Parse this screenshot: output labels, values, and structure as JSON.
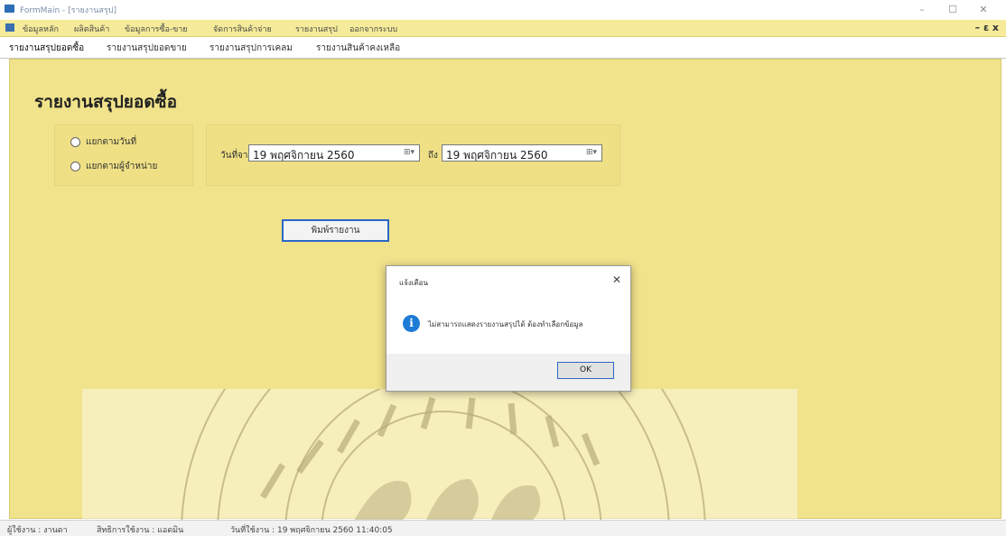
{
  "window": {
    "title": "FormMain - [รายงานสรุป]",
    "minimize": "–",
    "maximize": "☐",
    "close": "✕"
  },
  "menu": {
    "items": [
      "ข้อมูลหลัก",
      "ผลิตสินค้า",
      "ข้อมูลการซื้อ-ขาย",
      "จัดการสินค้าจ่าย",
      "รายงานสรุป",
      "ออกจากระบบ"
    ],
    "mdi_controls": "– ɛ x"
  },
  "tabs": [
    "รายงานสรุปยอดซื้อ",
    "รายงานสรุปยอดขาย",
    "รายงานสรุปการเคลม",
    "รายงานสินค้าคงเหลือ"
  ],
  "report": {
    "heading": "รายงานสรุปยอดซื้อ",
    "radio_by_date": "แยกตามวันที่",
    "radio_by_seller": "แยกตามผู้จำหน่าย",
    "from_label": "วันที่จาก",
    "to_label": "ถึง",
    "date_from": "19 พฤศจิกายน  2560",
    "date_to": "19 พฤศจิกายน  2560",
    "print_button": "พิมพ์รายงาน"
  },
  "dialog": {
    "title": "แจ้งเตือน",
    "message": "ไม่สามารถแสดงรายงานสรุปได้ ต้องทำเลือกข้อมูล",
    "ok": "OK",
    "close": "✕"
  },
  "status": {
    "user": "ผู้ใช้งาน : งานดา",
    "role": "สิทธิการใช้งาน : แอดมิน",
    "datetime": "วันที่ใช้งาน : 19 พฤศจิกายน 2560  11:40:05"
  },
  "colors": {
    "panel": "#f1e38b",
    "menubar": "#f5eb9a",
    "accent": "#2b67c8",
    "info": "#1e7bd6"
  }
}
